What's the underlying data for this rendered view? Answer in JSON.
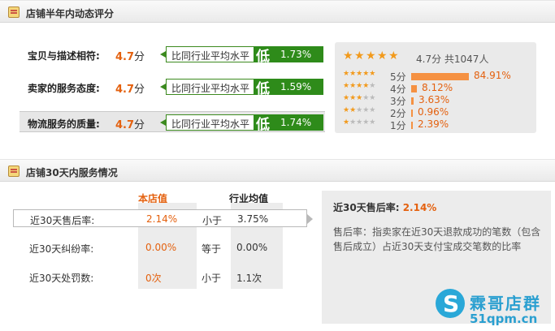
{
  "section1": {
    "title": "店铺半年内动态评分"
  },
  "ratings": [
    {
      "label": "宝贝与描述相符:",
      "score": "4.7",
      "unit": "分",
      "compare_text": "比同行业平均水平",
      "level": "低",
      "percent": "1.73%"
    },
    {
      "label": "卖家的服务态度:",
      "score": "4.7",
      "unit": "分",
      "compare_text": "比同行业平均水平",
      "level": "低",
      "percent": "1.59%"
    },
    {
      "label": "物流服务的质量:",
      "score": "4.7",
      "unit": "分",
      "compare_text": "比同行业平均水平",
      "level": "低",
      "percent": "1.74%"
    }
  ],
  "distribution": {
    "summary": "4.7分 共1047人",
    "rating_value": 4.7,
    "rows": [
      {
        "label": "5分",
        "percent": "84.91%",
        "value": 84.91,
        "stars": 5
      },
      {
        "label": "4分",
        "percent": "8.12%",
        "value": 8.12,
        "stars": 4
      },
      {
        "label": "3分",
        "percent": "3.63%",
        "value": 3.63,
        "stars": 3
      },
      {
        "label": "2分",
        "percent": "0.96%",
        "value": 0.96,
        "stars": 2
      },
      {
        "label": "1分",
        "percent": "2.39%",
        "value": 2.39,
        "stars": 1
      }
    ]
  },
  "section2": {
    "title": "店铺30天内服务情况"
  },
  "service": {
    "col_shop": "本店值",
    "col_avg": "行业均值",
    "rows": [
      {
        "label": "近30天售后率:",
        "value": "2.14%",
        "compare": "小于",
        "avg": "3.75%"
      },
      {
        "label": "近30天纠纷率:",
        "value": "0.00%",
        "compare": "等于",
        "avg": "0.00%"
      },
      {
        "label": "近30天处罚数:",
        "value": "0次",
        "compare": "小于",
        "avg": "1.1次"
      }
    ]
  },
  "detail": {
    "title": "近30天售后率:",
    "value": "2.14%",
    "text": "售后率：指卖家在近30天退款成功的笔数（包含售后成立）占近30天支付宝成交笔数的比率"
  },
  "watermark": {
    "name": "霖哥店群",
    "url": "51qpm.cn"
  },
  "colors": {
    "accent": "#e4610f",
    "green": "#2e8b1a",
    "star": "#f29a1c",
    "bar": "#f59142"
  }
}
